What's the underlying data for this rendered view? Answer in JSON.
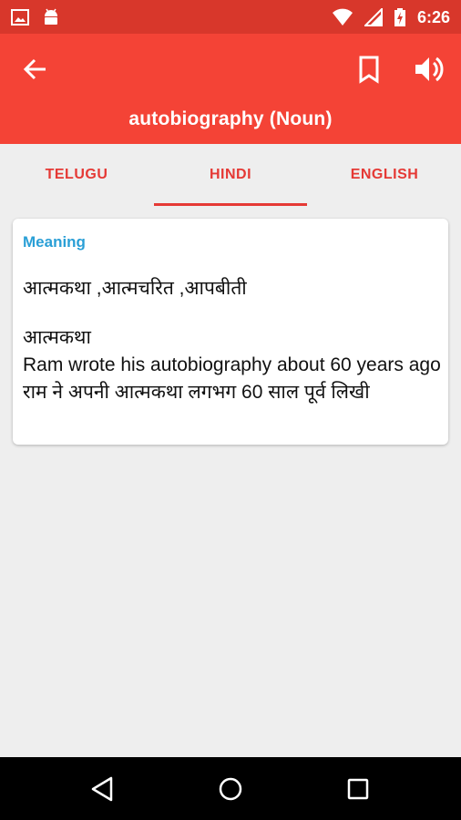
{
  "status_bar": {
    "time": "6:26",
    "icons": [
      "image-notification-icon",
      "android-notification-icon",
      "wifi-icon",
      "cellular-signal-icon",
      "battery-charging-icon"
    ]
  },
  "app_bar": {
    "title": "autobiography (Noun)",
    "icons": [
      "back-arrow-icon",
      "bookmark-icon",
      "volume-icon"
    ],
    "color": "#f44336"
  },
  "tabs": [
    {
      "label": "TELUGU",
      "active": false
    },
    {
      "label": "HINDI",
      "active": true
    },
    {
      "label": "ENGLISH",
      "active": false
    }
  ],
  "card": {
    "heading": "Meaning",
    "meanings": "आत्मकथा ,आत्मचरित ,आपबीती",
    "example": {
      "word": "आत्मकथा",
      "sentence_en": "Ram wrote his autobiography about 60 years ago",
      "sentence_hi": "राम ने अपनी आत्मकथा लगभग 60 साल पूर्व लिखी"
    }
  },
  "nav_bar": {
    "icons": [
      "back-triangle-icon",
      "home-circle-icon",
      "recents-square-icon"
    ]
  },
  "colors": {
    "status_bar": "#d8372b",
    "accent": "#e53935",
    "heading": "#2a9fd6",
    "background": "#eeeeee"
  }
}
